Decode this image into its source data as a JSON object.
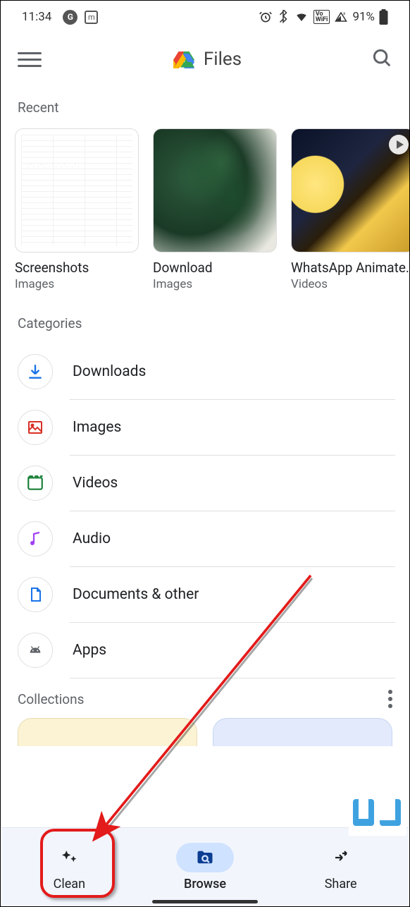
{
  "status_bar": {
    "time": "11:34",
    "battery": "91%",
    "icons": {
      "circle_g": "G",
      "box_m": "m",
      "alarm": "alarm",
      "bluetooth": "bluetooth",
      "wifi": "wifi",
      "volte": "Vo\nWiFi",
      "signal": "signal"
    }
  },
  "toolbar": {
    "title": "Files"
  },
  "recent": {
    "label": "Recent",
    "items": [
      {
        "title": "Screenshots",
        "subtitle": "Images"
      },
      {
        "title": "Download",
        "subtitle": "Images"
      },
      {
        "title": "WhatsApp Animated…",
        "subtitle": "Videos"
      }
    ]
  },
  "categories": {
    "label": "Categories",
    "items": [
      {
        "label": "Downloads",
        "icon": "download",
        "color": "#1a73e8"
      },
      {
        "label": "Images",
        "icon": "image",
        "color": "#d93025"
      },
      {
        "label": "Videos",
        "icon": "video",
        "color": "#188038"
      },
      {
        "label": "Audio",
        "icon": "audio",
        "color": "#a142f4"
      },
      {
        "label": "Documents & other",
        "icon": "document",
        "color": "#1a73e8"
      },
      {
        "label": "Apps",
        "icon": "android",
        "color": "#5f6368"
      }
    ]
  },
  "collections": {
    "label": "Collections"
  },
  "bottom_nav": {
    "items": [
      {
        "label": "Clean",
        "icon": "sparkle",
        "active": false
      },
      {
        "label": "Browse",
        "icon": "folder-search",
        "active": true
      },
      {
        "label": "Share",
        "icon": "share",
        "active": false
      }
    ]
  }
}
